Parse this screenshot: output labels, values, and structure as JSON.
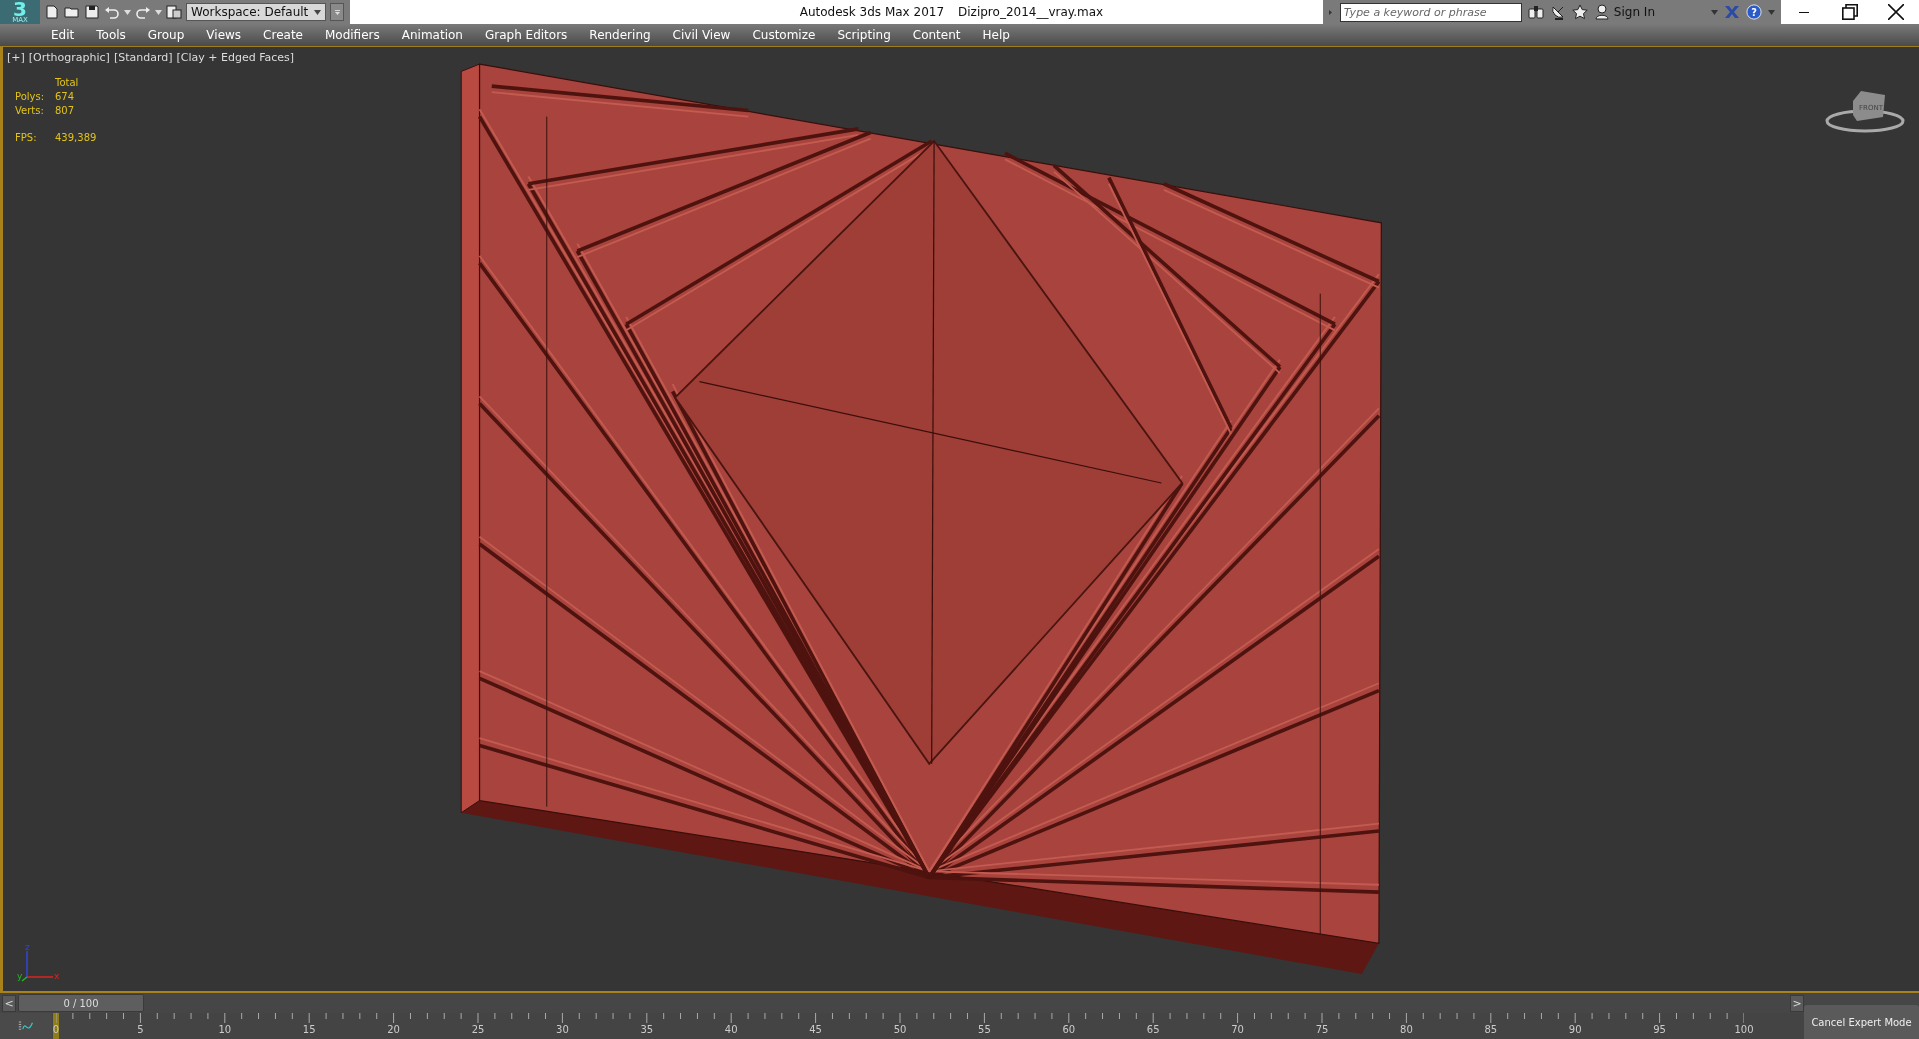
{
  "title_bar": {
    "logo": "3",
    "logo_sub": "MAX",
    "workspace": "Workspace: Default",
    "app_title": "Autodesk 3ds Max 2017",
    "file_name": "Dizipro_2014__vray.max",
    "search": {
      "placeholder": "Type a keyword or phrase"
    },
    "sign_in": "Sign In",
    "help": "?"
  },
  "menu": [
    "Edit",
    "Tools",
    "Group",
    "Views",
    "Create",
    "Modifiers",
    "Animation",
    "Graph Editors",
    "Rendering",
    "Civil View",
    "Customize",
    "Scripting",
    "Content",
    "Help"
  ],
  "viewport": {
    "labels": [
      "[+]",
      "[Orthographic]",
      "[Standard]",
      "[Clay + Edged Faces]"
    ],
    "stats": {
      "header": "Total",
      "rows": [
        {
          "label": "Polys:",
          "value": "674"
        },
        {
          "label": "Verts:",
          "value": "807"
        }
      ],
      "fps": {
        "label": "FPS:",
        "value": "439,389"
      }
    },
    "viewcube_face": "FRONT",
    "axes": [
      "z",
      "y",
      "x"
    ]
  },
  "time_slider": {
    "prev": "<",
    "next": ">",
    "frame": "0 / 100",
    "level": 0
  },
  "timeline": {
    "ticks": [
      "0",
      "5",
      "10",
      "15",
      "20",
      "25",
      "30",
      "35",
      "40",
      "45",
      "50",
      "55",
      "60",
      "65",
      "70",
      "75",
      "80",
      "85",
      "90",
      "95",
      "100"
    ]
  },
  "expert_button": "Cancel Expert Mode"
}
